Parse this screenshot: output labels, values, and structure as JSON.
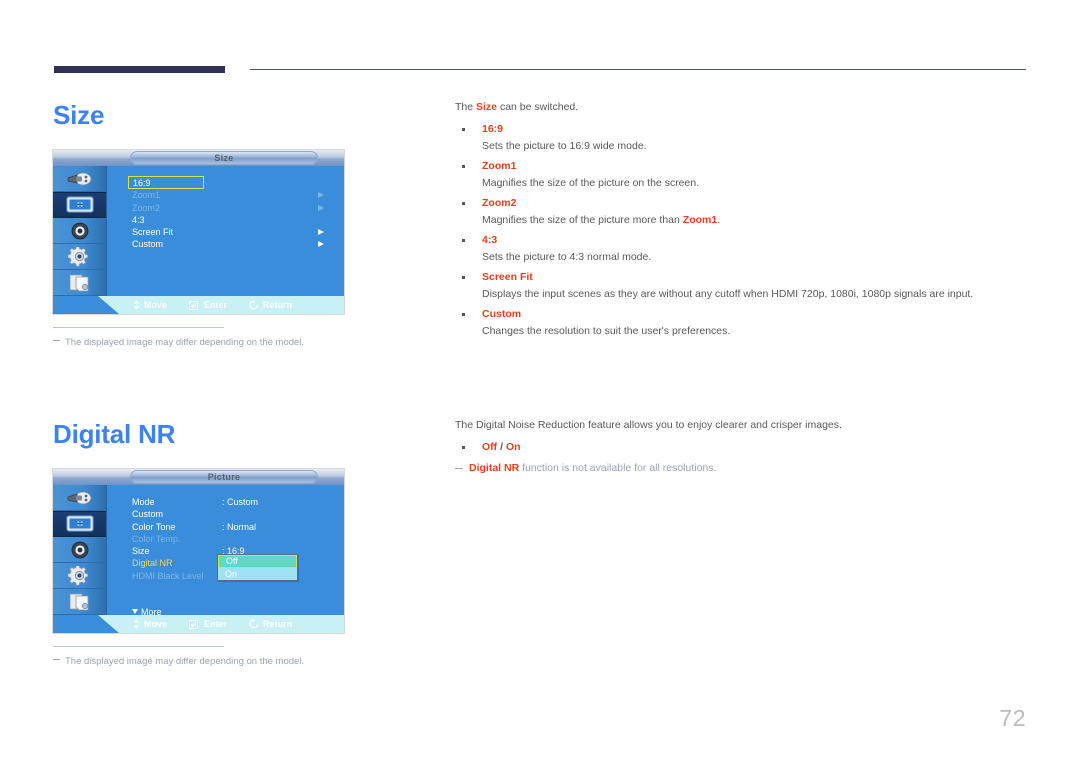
{
  "page": {
    "number": "72"
  },
  "sections": [
    {
      "heading": "Size",
      "lead_prefix": "The ",
      "lead_keyword": "Size",
      "lead_suffix": " can be switched.",
      "bullets": [
        {
          "term": "16:9",
          "desc": "Sets the picture to 16:9 wide mode."
        },
        {
          "term": "Zoom1",
          "desc": "Magnifies the size of the picture on the screen."
        },
        {
          "term": "Zoom2",
          "desc_prefix": "Magnifies the size of the picture more than ",
          "desc_keyword": "Zoom1",
          "desc_suffix": "."
        },
        {
          "term": "4:3",
          "desc": "Sets the picture to 4:3 normal mode."
        },
        {
          "term": "Screen Fit",
          "desc": "Displays the input scenes as they are without any cutoff when HDMI 720p, 1080i, 1080p signals are input."
        },
        {
          "term": "Custom",
          "desc": "Changes the resolution to suit the user's preferences."
        }
      ]
    },
    {
      "heading": "Digital NR",
      "lead": "The Digital Noise Reduction feature allows you to enjoy clearer and crisper images.",
      "bullets": [
        {
          "term_a": "Off",
          "term_sep": " / ",
          "term_b": "On"
        }
      ],
      "note_keyword": "Digital NR",
      "note_text": " function is not available for all resolutions."
    }
  ],
  "osd_size": {
    "title": "Size",
    "rows": [
      {
        "label": "16:9",
        "value": "",
        "state": "selected",
        "arrow": false
      },
      {
        "label": "Zoom1",
        "value": "",
        "state": "disabled",
        "arrow": true
      },
      {
        "label": "Zoom2",
        "value": "",
        "state": "disabled",
        "arrow": true
      },
      {
        "label": "4:3",
        "value": "",
        "state": "normal",
        "arrow": false
      },
      {
        "label": "Screen Fit",
        "value": "",
        "state": "normal",
        "arrow": true
      },
      {
        "label": "Custom",
        "value": "",
        "state": "normal",
        "arrow": true
      }
    ],
    "footer": [
      {
        "icon": "updown-arrow-icon",
        "label": "Move"
      },
      {
        "icon": "enter-key-icon",
        "label": "Enter"
      },
      {
        "icon": "return-arrow-icon",
        "label": "Return"
      }
    ],
    "sidebar_icons": [
      "input-source-icon",
      "picture-monitor-icon",
      "sound-speaker-icon",
      "setup-gear-icon",
      "multi-control-pages-icon"
    ],
    "caption": "The displayed image may differ depending on the model."
  },
  "osd_picture": {
    "title": "Picture",
    "rows": [
      {
        "label": "Mode",
        "value": ": Custom",
        "state": "normal"
      },
      {
        "label": "Custom",
        "value": "",
        "state": "normal"
      },
      {
        "label": "Color Tone",
        "value": ": Normal",
        "state": "normal"
      },
      {
        "label": "Color Temp.",
        "value": "",
        "state": "disabled"
      },
      {
        "label": "Size",
        "value": ": 16:9",
        "state": "normal"
      },
      {
        "label": "Digital NR",
        "value": ":",
        "state": "accent"
      },
      {
        "label": "HDMI Black Level",
        "value": ":",
        "state": "disabled"
      }
    ],
    "more_label": "More",
    "dropdown": {
      "selected": "Off",
      "other": "On"
    },
    "footer": [
      {
        "icon": "updown-arrow-icon",
        "label": "Move"
      },
      {
        "icon": "enter-key-icon",
        "label": "Enter"
      },
      {
        "icon": "return-arrow-icon",
        "label": "Return"
      }
    ],
    "caption": "The displayed image may differ depending on the model."
  },
  "colors": {
    "heading_blue": "#3d82f0",
    "keyword_red": "#e8401f",
    "body_gray": "#58595b",
    "note_gray": "#9aa2b4",
    "osd_blue": "#3a8ddb",
    "osd_highlight_yellow": "#d9e04c",
    "osd_footer_cyan": "#c8f1f6",
    "rule_navy": "#2f3155"
  }
}
